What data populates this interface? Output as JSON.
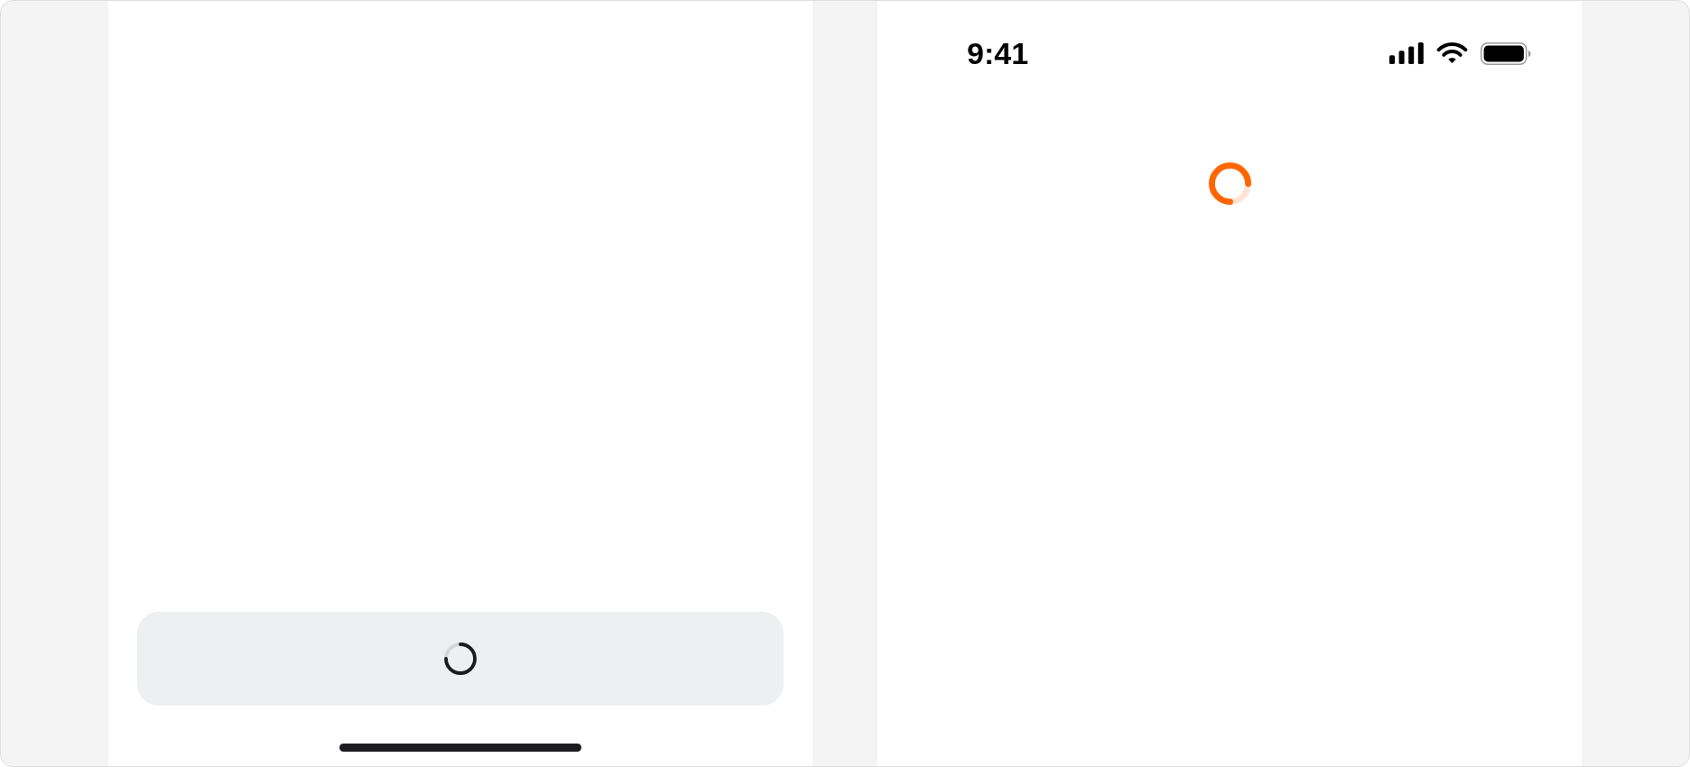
{
  "left_screen": {
    "button": {
      "loading": true
    }
  },
  "right_screen": {
    "status_bar": {
      "time": "9:41"
    },
    "loading": true
  }
}
